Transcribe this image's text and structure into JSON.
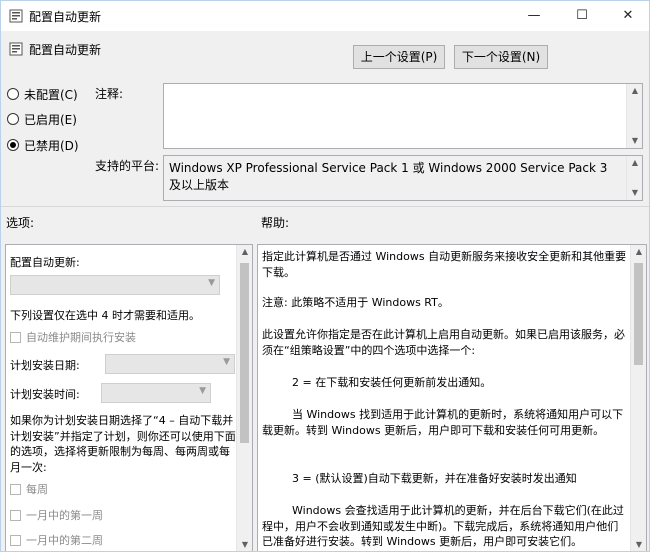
{
  "window": {
    "title": "配置自动更新",
    "min": "—",
    "max": "☐",
    "close": "✕"
  },
  "header": {
    "title": "配置自动更新",
    "prev_button": "上一个设置(P)",
    "next_button": "下一个设置(N)"
  },
  "state": {
    "options": [
      {
        "label": "未配置(C)",
        "checked": false
      },
      {
        "label": "已启用(E)",
        "checked": false
      },
      {
        "label": "已禁用(D)",
        "checked": true
      }
    ]
  },
  "comment": {
    "label": "注释:",
    "value": ""
  },
  "platform": {
    "label": "支持的平台:",
    "value": "Windows XP Professional Service Pack 1 或 Windows 2000 Service Pack 3 及以上版本"
  },
  "sections": {
    "options_label": "选项:",
    "help_label": "帮助:"
  },
  "options": {
    "heading": "配置自动更新:",
    "note": "下列设置仅在选中 4 时才需要和适用。",
    "maintenance": "自动维护期间执行安装",
    "schedule_day": "计划安装日期:",
    "schedule_time": "计划安装时间:",
    "desc": "如果你为计划安装日期选择了“4 – 自动下载并计划安装”并指定了计划，则你还可以使用下面的选项，选择将更新限制为每周、每两周或每月一次:",
    "weekly": "每周",
    "first_week": "一月中的第一周",
    "second_week": "一月中的第二周"
  },
  "help": {
    "p1": "指定此计算机是否通过 Windows 自动更新服务来接收安全更新和其他重要下载。",
    "p2": "注意: 此策略不适用于 Windows RT。",
    "p3": "此设置允许你指定是否在此计算机上启用自动更新。如果已启用该服务，必须在“组策略设置”中的四个选项中选择一个:",
    "p4": "2 = 在下载和安装任何更新前发出通知。",
    "p5": "当 Windows 找到适用于此计算机的更新时，系统将通知用户可以下载更新。转到 Windows 更新后，用户即可下载和安装任何可用更新。",
    "p6": "3 = (默认设置)自动下载更新，并在准备好安装时发出通知",
    "p7": "Windows 会查找适用于此计算机的更新，并在后台下载它们(在此过程中，用户不会收到通知或发生中断)。下载完成后，系统将通知用户他们已准备好进行安装。转到 Windows 更新后，用户即可安装它们。"
  }
}
